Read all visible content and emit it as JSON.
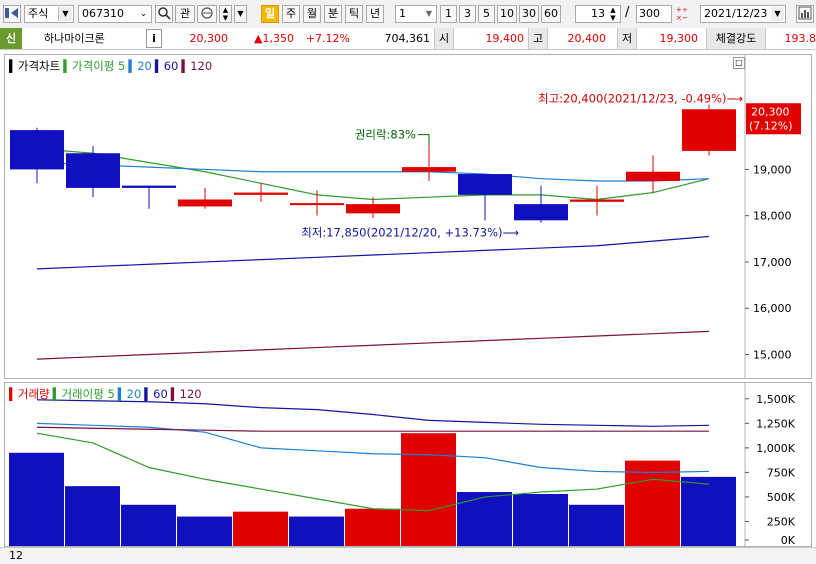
{
  "toolbar": {
    "menu_icon": "sidebar-toggle-icon",
    "market": "주식",
    "code": "067310",
    "hist_icon": "dropdown-history",
    "search_icon": "search-icon",
    "gwan": "관",
    "period_tabs": [
      "일",
      "주",
      "월",
      "분",
      "틱",
      "년"
    ],
    "active_period": "일",
    "interval_value": "1",
    "quick_intervals": [
      "1",
      "3",
      "5",
      "10",
      "30",
      "60"
    ],
    "count_value": "13",
    "count_sep": "/",
    "count_total": "300",
    "date_value": "2021/12/23",
    "calendar_icon": "calendar-icon",
    "settings_icon": "panel-settings-icon"
  },
  "info": {
    "badge": "신",
    "name": "하나마이크론",
    "info_button": "i",
    "price": "20,300",
    "change": "▲1,350",
    "change_pct": "+7.12%",
    "volume": "704,361",
    "open_label": "시",
    "open": "19,400",
    "high_label": "고",
    "high": "20,400",
    "low_label": "저",
    "low": "19,300",
    "strength_label": "체결강도",
    "strength": "193.8"
  },
  "price_panel": {
    "legend": [
      {
        "text": "가격차트",
        "color": "#000000"
      },
      {
        "text": "가격이평 5",
        "color": "#2e9c2e"
      },
      {
        "text": "20",
        "color": "#1e7fd0"
      },
      {
        "text": "60",
        "color": "#1515a0"
      },
      {
        "text": "120",
        "color": "#7a1040"
      }
    ],
    "price_tag": "20,300",
    "price_tag_pct": "(7.12%)",
    "high_note": "최고:20,400(2021/12/23, -0.49%)⟶",
    "low_note": "최저:17,850(2021/12/20, +13.73%)⟶",
    "event_note": "권리락:83%"
  },
  "volume_panel": {
    "legend": [
      {
        "text": "거래량",
        "color": "#e00000"
      },
      {
        "text": "거래이평 5",
        "color": "#2e9c2e"
      },
      {
        "text": "20",
        "color": "#1e7fd0"
      },
      {
        "text": "60",
        "color": "#1515a0"
      },
      {
        "text": "120",
        "color": "#7a1040"
      }
    ],
    "footer": "12"
  },
  "chart_data": [
    {
      "type": "candlestick",
      "title": "가격차트",
      "ylim": [
        14600,
        21300
      ],
      "y_ticks": [
        "19,000",
        "18,000",
        "17,000",
        "16,000",
        "15,000"
      ],
      "y_tick_values": [
        19000,
        18000,
        17000,
        16000,
        15000
      ],
      "candles": [
        {
          "open": 19850,
          "high": 19900,
          "low": 18700,
          "close": 19000
        },
        {
          "open": 19350,
          "high": 19500,
          "low": 18400,
          "close": 18600
        },
        {
          "open": 18650,
          "high": 18650,
          "low": 18150,
          "close": 18600
        },
        {
          "open": 18200,
          "high": 18600,
          "low": 18150,
          "close": 18350
        },
        {
          "open": 18450,
          "high": 18700,
          "low": 18300,
          "close": 18500
        },
        {
          "open": 18250,
          "high": 18550,
          "low": 18000,
          "close": 18250
        },
        {
          "open": 18050,
          "high": 18400,
          "low": 17950,
          "close": 18250
        },
        {
          "open": 18950,
          "high": 19600,
          "low": 18750,
          "close": 19050
        },
        {
          "open": 18900,
          "high": 18900,
          "low": 17900,
          "close": 18450
        },
        {
          "open": 18250,
          "high": 18650,
          "low": 17850,
          "close": 17900
        },
        {
          "open": 18300,
          "high": 18650,
          "low": 18000,
          "close": 18350
        },
        {
          "open": 18750,
          "high": 19300,
          "low": 18500,
          "close": 18950
        },
        {
          "open": 19400,
          "high": 20400,
          "low": 19300,
          "close": 20300
        }
      ],
      "series": [
        {
          "name": "가격이평 5",
          "color": "#2e9c2e",
          "values": [
            19450,
            19350,
            19150,
            18950,
            18700,
            18450,
            18350,
            18400,
            18450,
            18450,
            18350,
            18500,
            18800
          ]
        },
        {
          "name": "20",
          "color": "#1e7fd0",
          "values": [
            19150,
            19100,
            19050,
            19000,
            18950,
            18950,
            18950,
            18950,
            18900,
            18800,
            18750,
            18750,
            18800
          ]
        },
        {
          "name": "60",
          "color": "#1515a0",
          "values": [
            16850,
            16900,
            16950,
            17000,
            17050,
            17100,
            17150,
            17200,
            17250,
            17300,
            17350,
            17450,
            17550
          ]
        },
        {
          "name": "120",
          "color": "#7a1040",
          "values": [
            14900,
            14950,
            15000,
            15050,
            15100,
            15150,
            15200,
            15250,
            15300,
            15350,
            15400,
            15450,
            15500
          ]
        }
      ]
    },
    {
      "type": "bar",
      "title": "거래량",
      "ylim": [
        0,
        1600000
      ],
      "y_ticks": [
        "1,500K",
        "1,250K",
        "1,000K",
        "750K",
        "500K",
        "250K",
        "0K"
      ],
      "y_tick_values": [
        1500000,
        1250000,
        1000000,
        750000,
        500000,
        250000,
        0
      ],
      "values": [
        950000,
        610000,
        420000,
        300000,
        350000,
        300000,
        380000,
        1150000,
        550000,
        530000,
        420000,
        870000,
        704361
      ],
      "up": [
        false,
        false,
        false,
        false,
        true,
        false,
        true,
        true,
        false,
        false,
        false,
        true,
        false
      ],
      "series": [
        {
          "name": "거래이평 5",
          "color": "#2e9c2e",
          "values": [
            1150000,
            1050000,
            800000,
            680000,
            580000,
            480000,
            380000,
            360000,
            500000,
            550000,
            580000,
            680000,
            630000
          ]
        },
        {
          "name": "20",
          "color": "#1e7fd0",
          "values": [
            1250000,
            1230000,
            1210000,
            1160000,
            1000000,
            970000,
            940000,
            930000,
            900000,
            800000,
            760000,
            750000,
            760000
          ]
        },
        {
          "name": "60",
          "color": "#1515a0",
          "values": [
            1490000,
            1480000,
            1470000,
            1450000,
            1410000,
            1390000,
            1340000,
            1280000,
            1260000,
            1240000,
            1230000,
            1220000,
            1230000
          ]
        },
        {
          "name": "120",
          "color": "#7a1040",
          "values": [
            1210000,
            1200000,
            1190000,
            1180000,
            1170000,
            1170000,
            1170000,
            1170000,
            1170000,
            1170000,
            1170000,
            1170000,
            1170000
          ]
        }
      ]
    }
  ]
}
